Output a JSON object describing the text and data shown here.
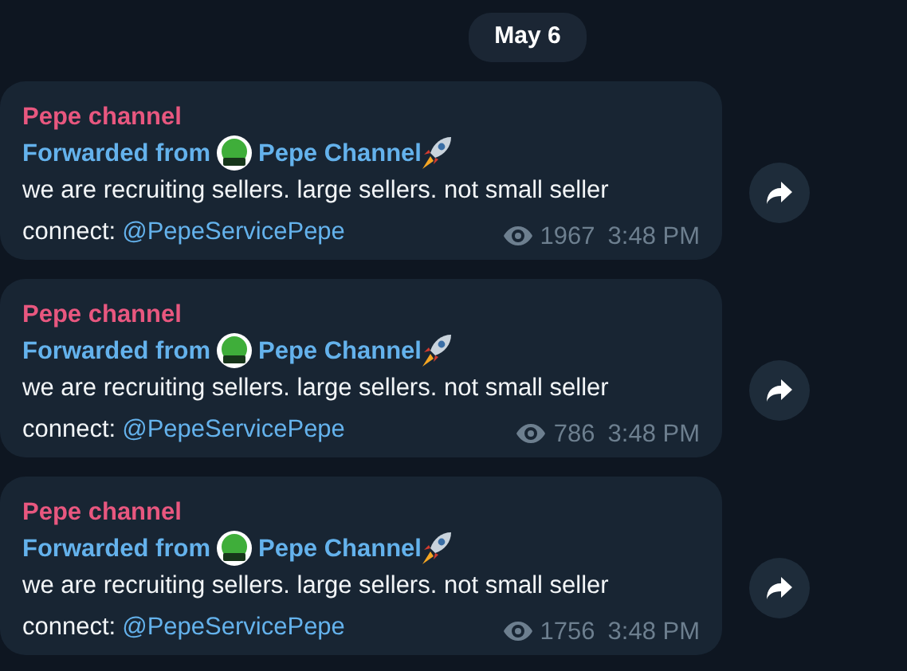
{
  "date_badge": "May 6",
  "messages": [
    {
      "sender": "Pepe channel",
      "forwarded_label": "Forwarded from",
      "forwarded_source": "Pepe Channel",
      "text": "we are recruiting sellers. large sellers. not small seller",
      "connect_label": "connect:",
      "mention": "@PepeServicePepe",
      "views": "1967",
      "time": "3:48 PM"
    },
    {
      "sender": "Pepe channel",
      "forwarded_label": "Forwarded from",
      "forwarded_source": "Pepe Channel",
      "text": "we are recruiting sellers. large sellers. not small seller",
      "connect_label": "connect:",
      "mention": "@PepeServicePepe",
      "views": "786",
      "time": "3:48 PM"
    },
    {
      "sender": "Pepe channel",
      "forwarded_label": "Forwarded from",
      "forwarded_source": "Pepe Channel",
      "text": "we are recruiting sellers. large sellers. not small seller",
      "connect_label": "connect:",
      "mention": "@PepeServicePepe",
      "views": "1756",
      "time": "3:48 PM"
    }
  ]
}
